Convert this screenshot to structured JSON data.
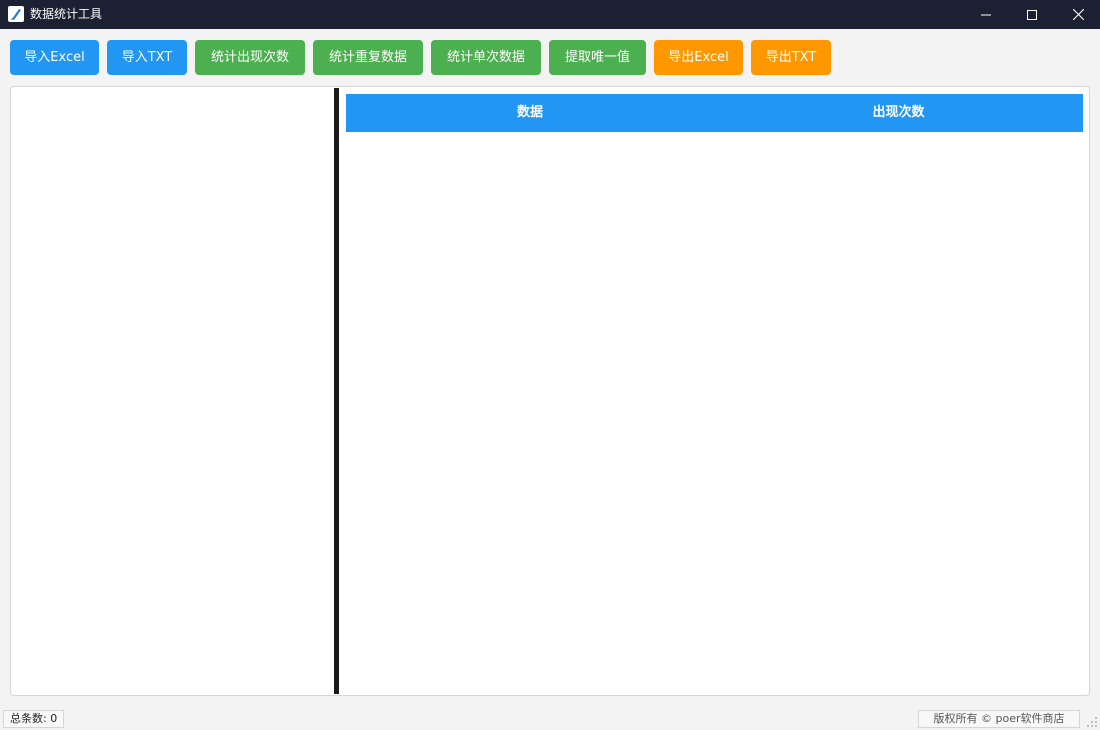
{
  "window": {
    "title": "数据统计工具",
    "icon": "feather-pen-icon"
  },
  "toolbar": {
    "buttons": [
      {
        "label": "导入Excel",
        "color": "#2196f3"
      },
      {
        "label": "导入TXT",
        "color": "#2196f3"
      },
      {
        "label": "统计出现次数",
        "color": "#4caf50"
      },
      {
        "label": "统计重复数据",
        "color": "#4caf50"
      },
      {
        "label": "统计单次数据",
        "color": "#4caf50"
      },
      {
        "label": "提取唯一值",
        "color": "#4caf50"
      },
      {
        "label": "导出Excel",
        "color": "#ff9800"
      },
      {
        "label": "导出TXT",
        "color": "#ff9800"
      }
    ]
  },
  "table": {
    "columns": [
      "数据",
      "出现次数"
    ],
    "rows": []
  },
  "status": {
    "total": "总条数: 0",
    "copyright": "版权所有 © poer软件商店"
  }
}
